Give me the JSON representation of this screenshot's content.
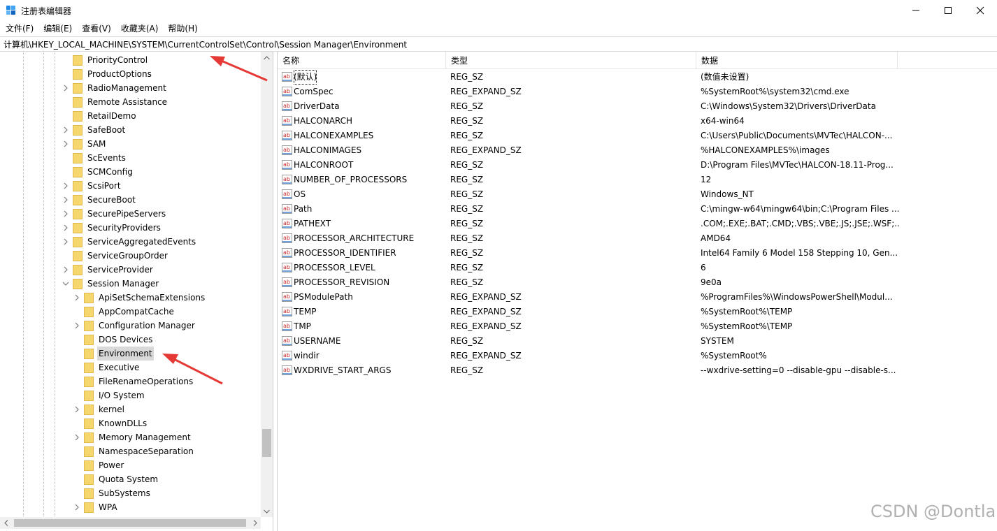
{
  "window": {
    "title": "注册表编辑器",
    "controls": {
      "minimize": "minimize-icon",
      "maximize": "maximize-icon",
      "close": "close-icon"
    }
  },
  "menu": [
    "文件(F)",
    "编辑(E)",
    "查看(V)",
    "收藏夹(A)",
    "帮助(H)"
  ],
  "address": "计算机\\HKEY_LOCAL_MACHINE\\SYSTEM\\CurrentControlSet\\Control\\Session Manager\\Environment",
  "tree": {
    "items": [
      {
        "label": "PriorityControl",
        "level": 1,
        "expandable": false
      },
      {
        "label": "ProductOptions",
        "level": 1,
        "expandable": false
      },
      {
        "label": "RadioManagement",
        "level": 1,
        "expandable": true
      },
      {
        "label": "Remote Assistance",
        "level": 1,
        "expandable": false
      },
      {
        "label": "RetailDemo",
        "level": 1,
        "expandable": false
      },
      {
        "label": "SafeBoot",
        "level": 1,
        "expandable": true
      },
      {
        "label": "SAM",
        "level": 1,
        "expandable": true
      },
      {
        "label": "ScEvents",
        "level": 1,
        "expandable": false
      },
      {
        "label": "SCMConfig",
        "level": 1,
        "expandable": false
      },
      {
        "label": "ScsiPort",
        "level": 1,
        "expandable": true
      },
      {
        "label": "SecureBoot",
        "level": 1,
        "expandable": true
      },
      {
        "label": "SecurePipeServers",
        "level": 1,
        "expandable": true
      },
      {
        "label": "SecurityProviders",
        "level": 1,
        "expandable": true
      },
      {
        "label": "ServiceAggregatedEvents",
        "level": 1,
        "expandable": true
      },
      {
        "label": "ServiceGroupOrder",
        "level": 1,
        "expandable": false
      },
      {
        "label": "ServiceProvider",
        "level": 1,
        "expandable": true
      },
      {
        "label": "Session Manager",
        "level": 1,
        "expandable": true,
        "expanded": true
      },
      {
        "label": "ApiSetSchemaExtensions",
        "level": 2,
        "expandable": true
      },
      {
        "label": "AppCompatCache",
        "level": 2,
        "expandable": false
      },
      {
        "label": "Configuration Manager",
        "level": 2,
        "expandable": true
      },
      {
        "label": "DOS Devices",
        "level": 2,
        "expandable": false
      },
      {
        "label": "Environment",
        "level": 2,
        "expandable": false,
        "selected": true
      },
      {
        "label": "Executive",
        "level": 2,
        "expandable": false
      },
      {
        "label": "FileRenameOperations",
        "level": 2,
        "expandable": false
      },
      {
        "label": "I/O System",
        "level": 2,
        "expandable": false
      },
      {
        "label": "kernel",
        "level": 2,
        "expandable": true
      },
      {
        "label": "KnownDLLs",
        "level": 2,
        "expandable": false
      },
      {
        "label": "Memory Management",
        "level": 2,
        "expandable": true
      },
      {
        "label": "NamespaceSeparation",
        "level": 2,
        "expandable": false
      },
      {
        "label": "Power",
        "level": 2,
        "expandable": false
      },
      {
        "label": "Quota System",
        "level": 2,
        "expandable": false
      },
      {
        "label": "SubSystems",
        "level": 2,
        "expandable": false
      },
      {
        "label": "WPA",
        "level": 2,
        "expandable": true
      }
    ]
  },
  "list": {
    "columns": [
      "名称",
      "类型",
      "数据"
    ],
    "rows": [
      {
        "name": "(默认)",
        "type": "REG_SZ",
        "data": "(数值未设置)"
      },
      {
        "name": "ComSpec",
        "type": "REG_EXPAND_SZ",
        "data": "%SystemRoot%\\system32\\cmd.exe"
      },
      {
        "name": "DriverData",
        "type": "REG_SZ",
        "data": "C:\\Windows\\System32\\Drivers\\DriverData"
      },
      {
        "name": "HALCONARCH",
        "type": "REG_SZ",
        "data": "x64-win64"
      },
      {
        "name": "HALCONEXAMPLES",
        "type": "REG_SZ",
        "data": "C:\\Users\\Public\\Documents\\MVTec\\HALCON-..."
      },
      {
        "name": "HALCONIMAGES",
        "type": "REG_EXPAND_SZ",
        "data": "%HALCONEXAMPLES%\\images"
      },
      {
        "name": "HALCONROOT",
        "type": "REG_SZ",
        "data": "D:\\Program Files\\MVTec\\HALCON-18.11-Prog..."
      },
      {
        "name": "NUMBER_OF_PROCESSORS",
        "type": "REG_SZ",
        "data": "12"
      },
      {
        "name": "OS",
        "type": "REG_SZ",
        "data": "Windows_NT"
      },
      {
        "name": "Path",
        "type": "REG_SZ",
        "data": "C:\\mingw-w64\\mingw64\\bin;C:\\Program Files ..."
      },
      {
        "name": "PATHEXT",
        "type": "REG_SZ",
        "data": ".COM;.EXE;.BAT;.CMD;.VBS;.VBE;.JS;.JSE;.WSF;...."
      },
      {
        "name": "PROCESSOR_ARCHITECTURE",
        "type": "REG_SZ",
        "data": "AMD64"
      },
      {
        "name": "PROCESSOR_IDENTIFIER",
        "type": "REG_SZ",
        "data": "Intel64 Family 6 Model 158 Stepping 10, Gen..."
      },
      {
        "name": "PROCESSOR_LEVEL",
        "type": "REG_SZ",
        "data": "6"
      },
      {
        "name": "PROCESSOR_REVISION",
        "type": "REG_SZ",
        "data": "9e0a"
      },
      {
        "name": "PSModulePath",
        "type": "REG_EXPAND_SZ",
        "data": "%ProgramFiles%\\WindowsPowerShell\\Modul..."
      },
      {
        "name": "TEMP",
        "type": "REG_EXPAND_SZ",
        "data": "%SystemRoot%\\TEMP"
      },
      {
        "name": "TMP",
        "type": "REG_EXPAND_SZ",
        "data": "%SystemRoot%\\TEMP"
      },
      {
        "name": "USERNAME",
        "type": "REG_SZ",
        "data": "SYSTEM"
      },
      {
        "name": "windir",
        "type": "REG_EXPAND_SZ",
        "data": "%SystemRoot%"
      },
      {
        "name": "WXDRIVE_START_ARGS",
        "type": "REG_SZ",
        "data": "--wxdrive-setting=0 --disable-gpu --disable-s..."
      }
    ]
  },
  "watermark": "CSDN @Dontla",
  "colors": {
    "annotation_arrow": "#e53935",
    "folder": "#f5d76e",
    "selection": "#d9d9d9"
  }
}
